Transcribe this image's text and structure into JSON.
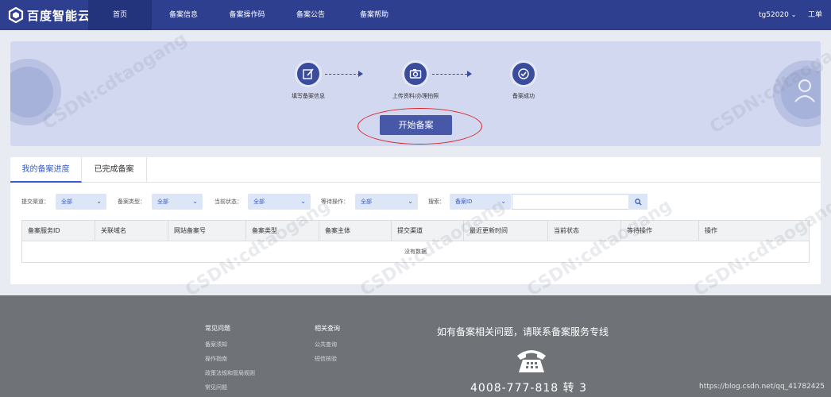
{
  "nav": {
    "logo": "百度智能云",
    "items": [
      "首页",
      "备案信息",
      "备案操作码",
      "备案公告",
      "备案帮助"
    ],
    "user": "tg52020",
    "ticket": "工单"
  },
  "hero": {
    "steps": [
      "填写备案信息",
      "上传资料/办理拍照",
      "备案成功"
    ],
    "start_button": "开始备案"
  },
  "tabs": [
    "我的备案进度",
    "已完成备案"
  ],
  "filters": {
    "channel_label": "提交渠道：",
    "channel_value": "全部",
    "type_label": "备案类型：",
    "type_value": "全部",
    "status_label": "当前状态：",
    "status_value": "全部",
    "waiting_label": "等待操作：",
    "waiting_value": "全部",
    "search_label": "搜索：",
    "search_field": "备案ID",
    "search_value": ""
  },
  "table": {
    "columns": [
      "备案服务ID",
      "关联域名",
      "网站备案号",
      "备案类型",
      "备案主体",
      "提交渠道",
      "最近更新时间",
      "当前状态",
      "等待操作",
      "操作"
    ],
    "empty_text": "没有数据"
  },
  "footer": {
    "col1_title": "常见问题",
    "col1_links": [
      "备案须知",
      "操作指南",
      "政策法规和管局规则",
      "常见问题"
    ],
    "col2_title": "相关查询",
    "col2_links": [
      "公共查询",
      "短信核验"
    ],
    "hotline": "如有备案相关问题，请联系备案服务专线",
    "phone": "4008-777-818 转 3",
    "url": "https://blog.csdn.net/qq_41782425"
  },
  "watermark": "CSDN:cdtaogang",
  "colors": {
    "nav_bg": "#2f3f8f",
    "accent": "#3a5bc7",
    "button": "#4858a8",
    "highlight_ring": "#d9252a"
  }
}
